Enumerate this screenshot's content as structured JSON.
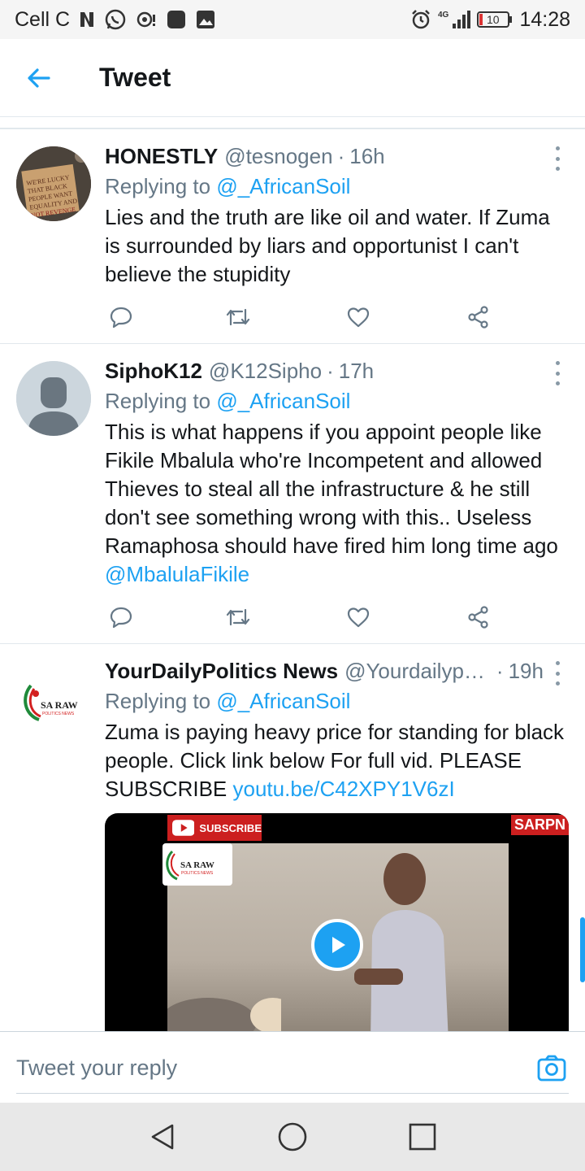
{
  "status_bar": {
    "carrier": "Cell C",
    "network": "4G",
    "battery": "10",
    "time": "14:28"
  },
  "header": {
    "title": "Tweet"
  },
  "tweets": [
    {
      "name": "HONESTLY",
      "handle": "@tesnogen",
      "separator": "·",
      "time": "16h",
      "replying_prefix": "Replying to",
      "replying_to": "@_AfricanSoil",
      "text": "Lies and the truth are like oil and water. If Zuma is surrounded by liars and opportunist I can't believe the stupidity",
      "avatar_sign_text": "WE'RE LUCKY THAT BLACK PEOPLE WANT EQUALITY AND NOT REVENGE"
    },
    {
      "name": "SiphoK12",
      "handle": "@K12Sipho",
      "separator": "·",
      "time": "17h",
      "replying_prefix": "Replying to",
      "replying_to": "@_AfricanSoil",
      "text": "This is what happens if you appoint people like Fikile Mbalula who're Incompetent and allowed Thieves to steal all the infrastructure & he still don't see something wrong with this.. Useless Ramaphosa should have fired him long time ago",
      "text_mention": "@MbalulaFikile"
    },
    {
      "name": "YourDailyPolitics News",
      "handle": "@Yourdailyp…",
      "separator": "·",
      "time": "19h",
      "replying_prefix": "Replying to",
      "replying_to": "@_AfricanSoil",
      "text": "Zuma is paying heavy price for standing for black people. Click link below For full vid. PLEASE SUBSCRIBE",
      "text_link": "youtu.be/C42XPY1V6zI",
      "avatar_logo_text": "SA RAW",
      "avatar_logo_sub": "POLITICS NEWS",
      "media": {
        "subscribe_label": "SUBSCRIBE",
        "channel_tag": "SARPN",
        "logo_text": "SA RAW",
        "logo_sub": "POLITICS NEWS"
      }
    }
  ],
  "reply_bar": {
    "placeholder": "Tweet your reply"
  },
  "colors": {
    "accent": "#1da1f2",
    "text_primary": "#14171a",
    "text_secondary": "#657786"
  },
  "icons": {
    "back": "arrow-left-icon",
    "reply": "reply-icon",
    "retweet": "retweet-icon",
    "like": "heart-icon",
    "share": "share-icon",
    "more": "more-vertical-icon",
    "camera": "camera-icon",
    "nav_back": "triangle-back-icon",
    "nav_home": "circle-home-icon",
    "nav_recents": "square-recents-icon"
  }
}
